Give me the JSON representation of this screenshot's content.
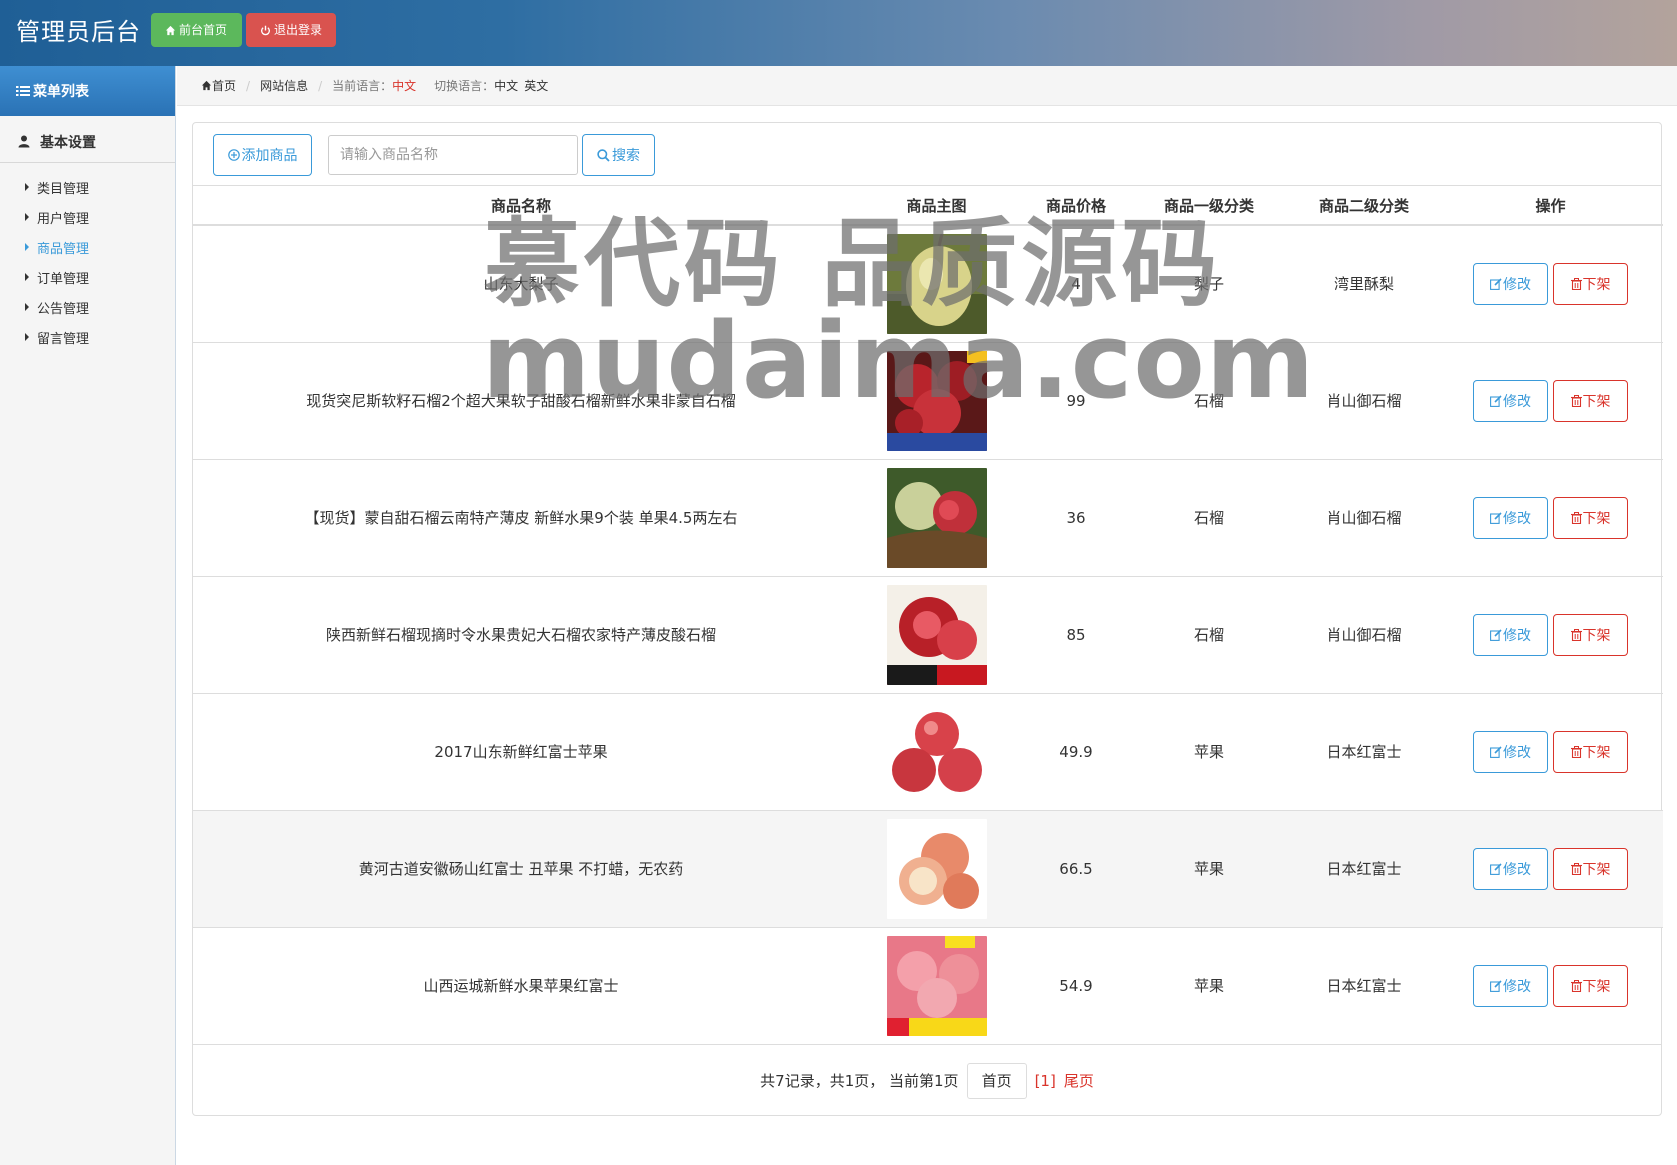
{
  "header": {
    "brand": "管理员后台",
    "home_btn": "前台首页",
    "logout_btn": "退出登录"
  },
  "sidebar": {
    "menu_title": "菜单列表",
    "section_title": "基本设置",
    "items": [
      {
        "label": "类目管理"
      },
      {
        "label": "用户管理"
      },
      {
        "label": "商品管理"
      },
      {
        "label": "订单管理"
      },
      {
        "label": "公告管理"
      },
      {
        "label": "留言管理"
      }
    ]
  },
  "breadcrumb": {
    "home": "首页",
    "page": "网站信息",
    "current_lang_label": "当前语言：",
    "current_lang": "中文",
    "switch_label": "切换语言：",
    "lang_cn": "中文",
    "lang_en": "英文"
  },
  "toolbar": {
    "add_label": "添加商品",
    "search_placeholder": "请输入商品名称",
    "search_label": "搜索"
  },
  "table": {
    "headers": [
      "商品名称",
      "商品主图",
      "商品价格",
      "商品一级分类",
      "商品二级分类",
      "操作"
    ],
    "edit_label": "修改",
    "remove_label": "下架",
    "rows": [
      {
        "name": "山东大梨子",
        "price": "4",
        "cat1": "梨子",
        "cat2": "湾里酥梨"
      },
      {
        "name": "现货突尼斯软籽石榴2个超大果软子甜酸石榴新鲜水果非蒙自石榴",
        "price": "99",
        "cat1": "石榴",
        "cat2": "肖山御石榴"
      },
      {
        "name": "【现货】蒙自甜石榴云南特产薄皮 新鲜水果9个装 单果4.5两左右",
        "price": "36",
        "cat1": "石榴",
        "cat2": "肖山御石榴"
      },
      {
        "name": "陕西新鲜石榴现摘时令水果贵妃大石榴农家特产薄皮酸石榴",
        "price": "85",
        "cat1": "石榴",
        "cat2": "肖山御石榴"
      },
      {
        "name": "2017山东新鲜红富士苹果",
        "price": "49.9",
        "cat1": "苹果",
        "cat2": "日本红富士"
      },
      {
        "name": "黄河古道安徽砀山红富士 丑苹果 不打蜡，无农药",
        "price": "66.5",
        "cat1": "苹果",
        "cat2": "日本红富士"
      },
      {
        "name": "山西运城新鲜水果苹果红富士",
        "price": "54.9",
        "cat1": "苹果",
        "cat2": "日本红富士"
      }
    ]
  },
  "pager": {
    "summary": "共7记录，共1页， 当前第1页",
    "first": "首页",
    "current": "[1]",
    "last": "尾页"
  },
  "watermark": {
    "line1": "慕代码 品质源码",
    "line2": "mudaima.com"
  }
}
